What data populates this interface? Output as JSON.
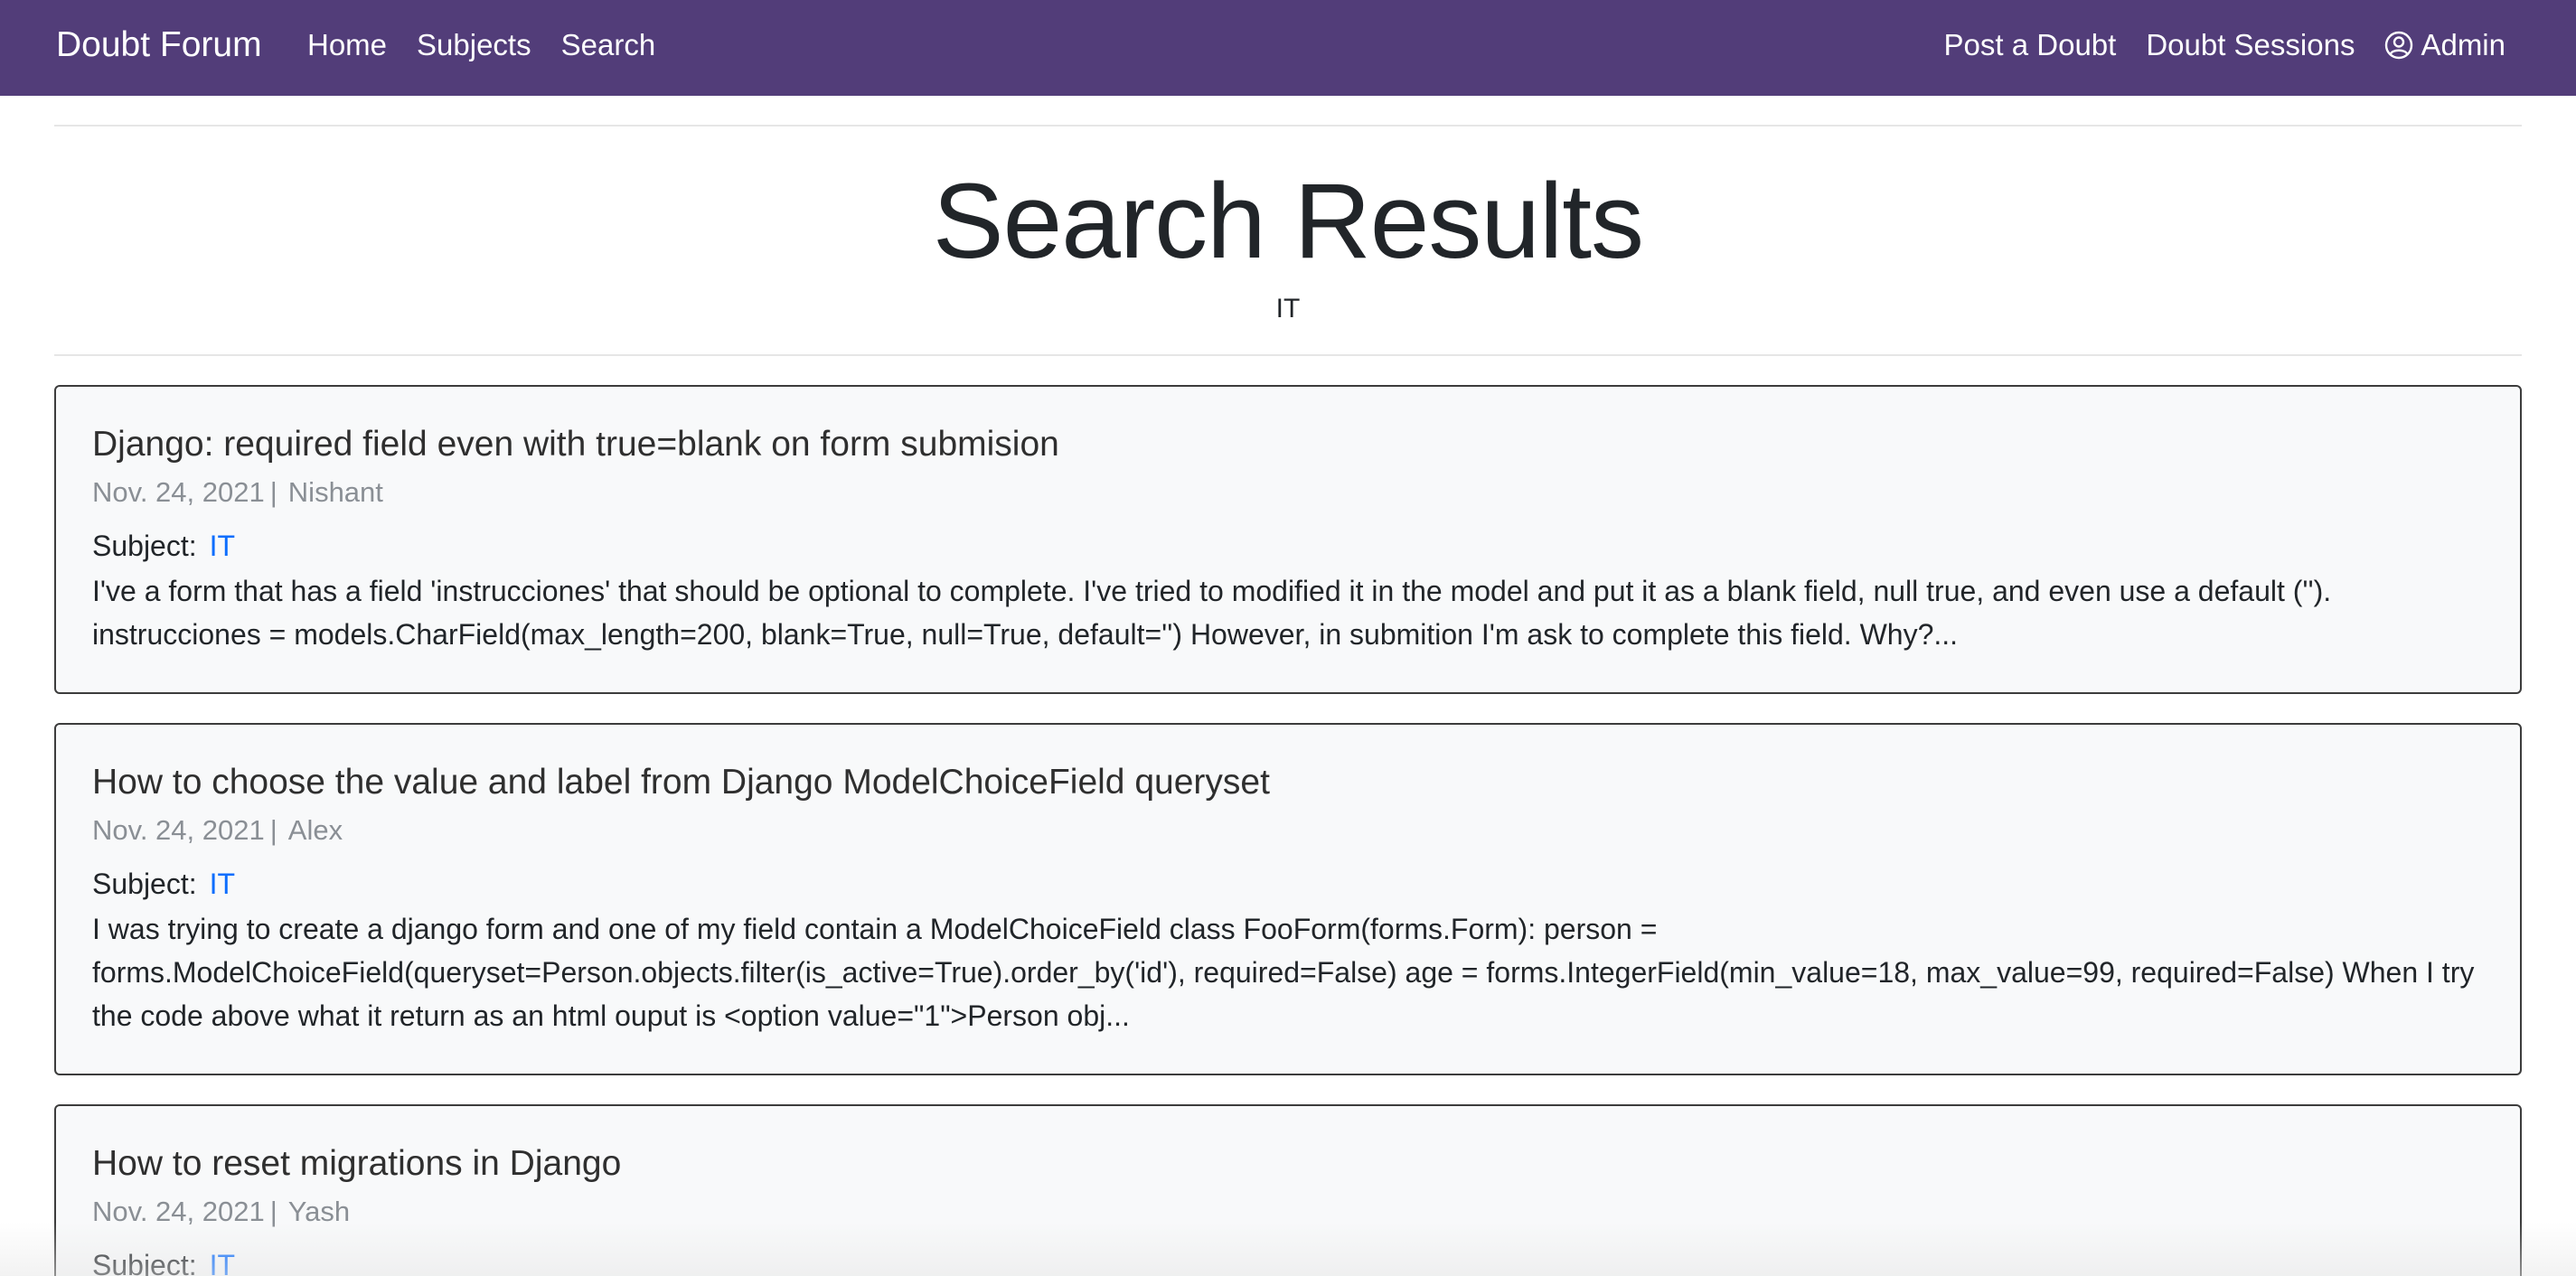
{
  "navbar": {
    "brand": "Doubt Forum",
    "left_links": [
      "Home",
      "Subjects",
      "Search"
    ],
    "right_links": [
      "Post a Doubt",
      "Doubt Sessions"
    ],
    "user_label": "Admin",
    "bg_color": "#523d79"
  },
  "header": {
    "title": "Search Results",
    "query": "IT"
  },
  "results": [
    {
      "title": "Django: required field even with true=blank on form submision",
      "date": "Nov. 24, 2021",
      "author": "Nishant",
      "subject_label": "Subject:",
      "subject": "IT",
      "excerpt": "I've a form that has a field 'instrucciones' that should be optional to complete. I've tried to modified it in the model and put it as a blank field, null true, and even use a default (''). instrucciones = models.CharField(max_length=200, blank=True, null=True, default='') However, in submition I'm ask to complete this field. Why?..."
    },
    {
      "title": "How to choose the value and label from Django ModelChoiceField queryset",
      "date": "Nov. 24, 2021",
      "author": "Alex",
      "subject_label": "Subject:",
      "subject": "IT",
      "excerpt": "I was trying to create a django form and one of my field contain a ModelChoiceField class FooForm(forms.Form): person = forms.ModelChoiceField(queryset=Person.objects.filter(is_active=True).order_by('id'), required=False) age = forms.IntegerField(min_value=18, max_value=99, required=False) When I try the code above what it return as an html ouput is <option value=\"1\">Person obj..."
    },
    {
      "title": "How to reset migrations in Django",
      "date": "Nov. 24, 2021",
      "author": "Yash",
      "subject_label": "Subject:",
      "subject": "IT",
      "excerpt": ""
    }
  ]
}
